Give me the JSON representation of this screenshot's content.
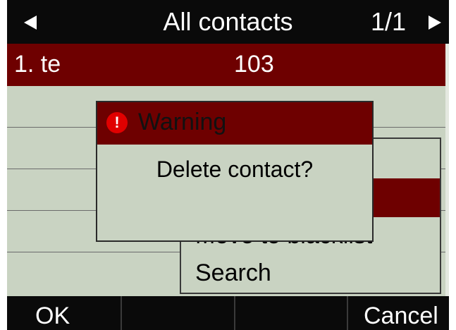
{
  "title_bar": {
    "title": "All contacts",
    "page_indicator": "1/1"
  },
  "contacts": [
    {
      "name": "1. te",
      "number": "103",
      "selected": true
    }
  ],
  "options_menu": {
    "items": [
      {
        "label": "",
        "selected": true
      },
      {
        "label": "Move to blacklist",
        "selected": false
      },
      {
        "label": "Search",
        "selected": false
      }
    ]
  },
  "warning_dialog": {
    "title": "Warning",
    "icon": "exclamation-icon",
    "message": "Delete contact?"
  },
  "softkeys": [
    "OK",
    "",
    "",
    "Cancel"
  ],
  "colors": {
    "background": "#c9d3c2",
    "highlight": "#6e0000",
    "bar": "#0a0a0a",
    "warning_icon": "#e00000"
  }
}
